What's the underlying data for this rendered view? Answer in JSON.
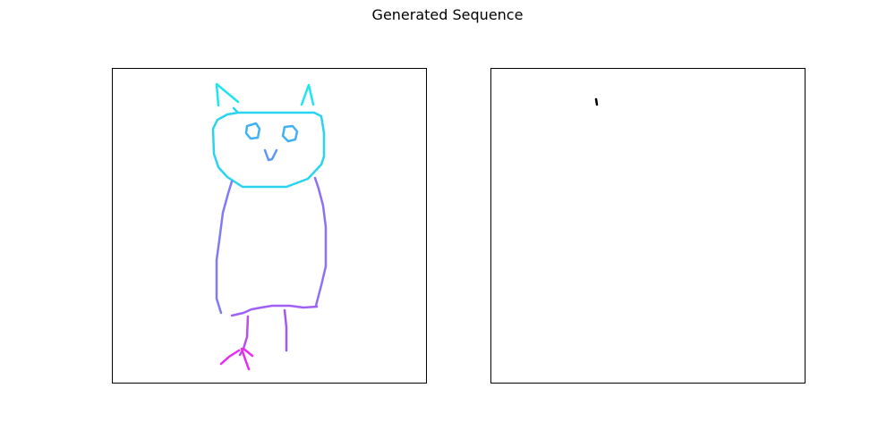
{
  "figure": {
    "title": "Generated Sequence"
  },
  "colors": {
    "frame": "#000000",
    "background": "#ffffff",
    "ears": "#1ee6ee",
    "head": "#29d4f0",
    "eyes": "#42b1f3",
    "mouth": "#5c97f5",
    "body_left": "#7f7af6",
    "body_right": "#8e70f4",
    "bottom": "#a160f5",
    "leg_left": "#b44ff3",
    "leg_right": "#a457ef",
    "foot": "#e92af0",
    "generated": "#000000"
  },
  "panels": [
    {
      "name": "source-drawing",
      "strokes": [
        {
          "name": "left-ear",
          "color": "ears",
          "points": [
            [
              118,
              41
            ],
            [
              116,
              17
            ],
            [
              140,
              37
            ]
          ]
        },
        {
          "name": "right-ear",
          "color": "ears",
          "points": [
            [
              211,
              40
            ],
            [
              219,
              18
            ],
            [
              224,
              40
            ]
          ]
        },
        {
          "name": "head-top",
          "color": "head",
          "points": [
            [
              135,
              44
            ],
            [
              140,
              49
            ],
            [
              225,
              49
            ],
            [
              233,
              53
            ],
            [
              236,
              72
            ],
            [
              236,
              98
            ],
            [
              233,
              107
            ],
            [
              218,
              123
            ],
            [
              194,
              132
            ],
            [
              145,
              132
            ],
            [
              128,
              121
            ],
            [
              118,
              110
            ],
            [
              113,
              95
            ],
            [
              112,
              67
            ],
            [
              117,
              57
            ],
            [
              128,
              51
            ],
            [
              140,
              49
            ]
          ]
        },
        {
          "name": "left-eye",
          "color": "eyes",
          "points": [
            [
              150,
              64
            ],
            [
              160,
              61
            ],
            [
              164,
              67
            ],
            [
              162,
              77
            ],
            [
              154,
              78
            ],
            [
              149,
              72
            ],
            [
              150,
              64
            ]
          ]
        },
        {
          "name": "right-eye",
          "color": "eyes",
          "points": [
            [
              192,
              65
            ],
            [
              201,
              64
            ],
            [
              206,
              70
            ],
            [
              204,
              79
            ],
            [
              196,
              81
            ],
            [
              190,
              75
            ],
            [
              192,
              65
            ]
          ]
        },
        {
          "name": "mouth",
          "color": "mouth",
          "points": [
            [
              170,
              91
            ],
            [
              174,
              102
            ],
            [
              178,
              101
            ],
            [
              183,
              91
            ]
          ]
        },
        {
          "name": "body-left",
          "color": "body_left",
          "points": [
            [
              133,
              126
            ],
            [
              129,
              139
            ],
            [
              123,
              161
            ],
            [
              119,
              192
            ],
            [
              116,
              214
            ],
            [
              116,
              257
            ],
            [
              121,
              273
            ]
          ]
        },
        {
          "name": "body-right",
          "color": "body_right",
          "points": [
            [
              226,
              122
            ],
            [
              230,
              134
            ],
            [
              235,
              153
            ],
            [
              238,
              177
            ],
            [
              238,
              221
            ],
            [
              233,
              242
            ],
            [
              227,
              265
            ]
          ]
        },
        {
          "name": "body-bottom",
          "color": "bottom",
          "points": [
            [
              133,
              276
            ],
            [
              146,
              273
            ],
            [
              155,
              269
            ],
            [
              166,
              267
            ],
            [
              178,
              265
            ],
            [
              198,
              265
            ],
            [
              213,
              267
            ],
            [
              228,
              266
            ]
          ]
        },
        {
          "name": "left-leg",
          "color": "leg_left",
          "points": [
            [
              151,
              277
            ],
            [
              150,
              300
            ],
            [
              146,
              313
            ],
            [
              142,
              320
            ]
          ]
        },
        {
          "name": "right-leg",
          "color": "leg_right",
          "points": [
            [
              192,
              270
            ],
            [
              194,
              289
            ],
            [
              194,
              315
            ]
          ]
        },
        {
          "name": "left-foot",
          "color": "foot",
          "points": [
            [
              121,
              330
            ],
            [
              130,
              322
            ],
            [
              141,
              315
            ]
          ]
        },
        {
          "name": "foot-claw",
          "color": "foot",
          "points": [
            [
              144,
              313
            ],
            [
              147,
              322
            ],
            [
              152,
              336
            ]
          ]
        },
        {
          "name": "foot-toe",
          "color": "foot",
          "points": [
            [
              146,
              313
            ],
            [
              156,
              321
            ]
          ]
        }
      ]
    },
    {
      "name": "generated-sequence",
      "strokes": [
        {
          "name": "generated-stroke",
          "color": "generated",
          "points": [
            [
              117,
              34
            ],
            [
              118,
              40
            ]
          ]
        }
      ]
    }
  ]
}
